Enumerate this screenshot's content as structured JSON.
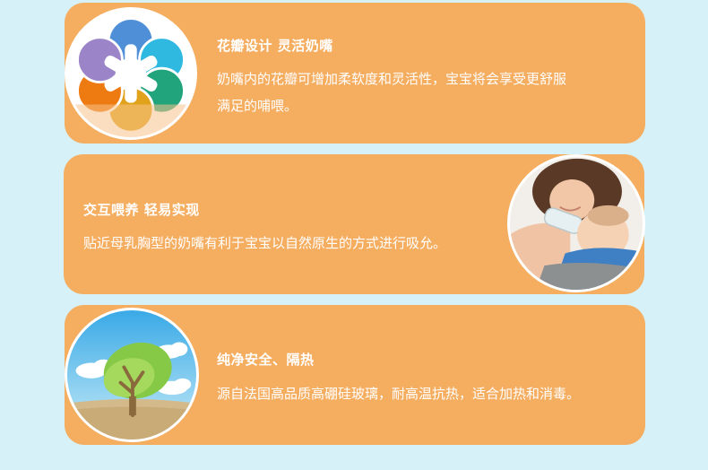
{
  "features": [
    {
      "title": "花瓣设计 灵活奶嘴",
      "desc_lines": [
        "奶嘴内的花瓣可增加柔软度和灵活性，宝宝将会享受更舒服",
        "满足的哺喂。"
      ],
      "icon": "flower-petal-icon"
    },
    {
      "title": "交互喂养 轻易实现",
      "desc_lines": [
        "贴近母乳胸型的奶嘴有利于宝宝以自然原生的方式进行吸允。"
      ],
      "icon": "mother-feeding-baby-photo"
    },
    {
      "title": "纯净安全、隔热",
      "desc_lines": [
        "源自法国高品质高硼硅玻璃，耐高温抗热，适合加热和消毒。"
      ],
      "icon": "tree-cloud-icon"
    }
  ],
  "colors": {
    "background": "#d6f1f8",
    "card": "#f5ad60",
    "text": "#ffffff"
  }
}
